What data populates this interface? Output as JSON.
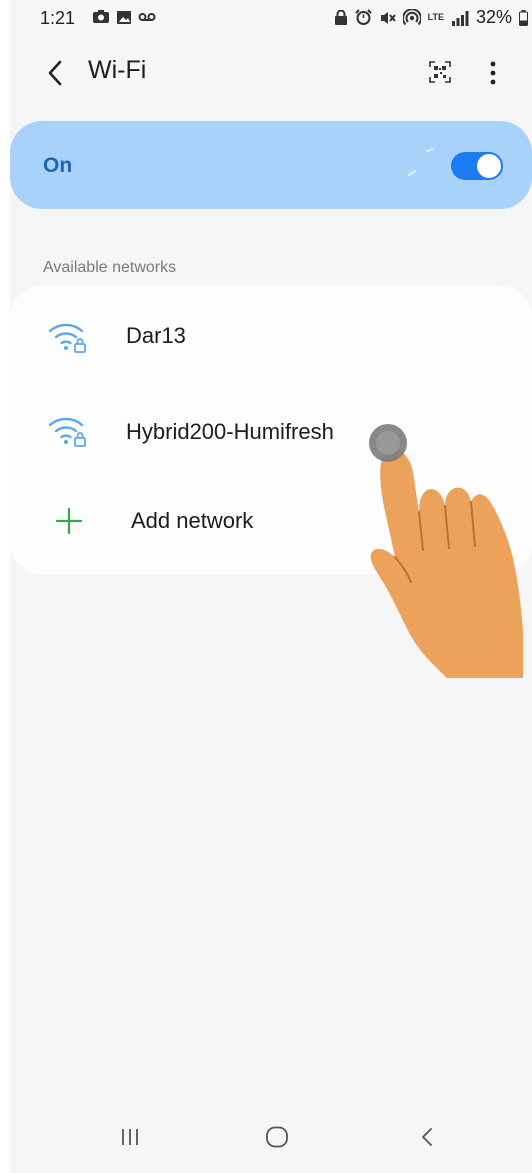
{
  "status_bar": {
    "time": "1:21",
    "left_icons": [
      "camera-switch-icon",
      "image-icon",
      "voicemail-icon"
    ],
    "right_icons": [
      "lock-icon",
      "alarm-icon",
      "mute-icon",
      "hotspot-icon",
      "lte-icon",
      "signal-icon",
      "battery-icon"
    ],
    "lte": "LTE",
    "battery": "32%"
  },
  "header": {
    "title": "Wi-Fi",
    "back_icon": "chevron-left-icon",
    "qr_icon": "qr-scan-icon",
    "more_icon": "more-vertical-icon"
  },
  "wifi_toggle": {
    "label": "On",
    "state": "on",
    "accent": "#1b7bf0",
    "card_color": "#a9d2fb"
  },
  "section": {
    "available_label": "Available networks"
  },
  "networks": [
    {
      "name": "Dar13",
      "icon": "wifi-lock-icon"
    },
    {
      "name": "Hybrid200-Humifresh",
      "icon": "wifi-lock-icon"
    }
  ],
  "add_network": {
    "label": "Add network",
    "icon": "plus-icon",
    "color": "#2fa84f"
  },
  "overlay": {
    "icon": "tap-hand-icon"
  },
  "nav_bar": {
    "recent_icon": "recent-apps-icon",
    "home_icon": "home-icon",
    "back_icon": "back-icon"
  }
}
